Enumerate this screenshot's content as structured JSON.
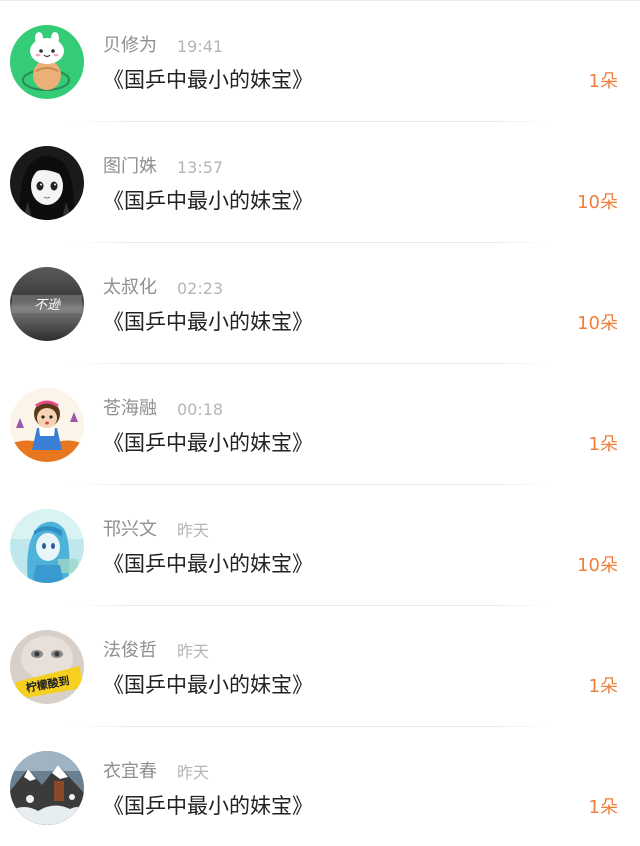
{
  "list": [
    {
      "name": "贝修为",
      "time": "19:41",
      "title": "《国乒中最小的妹宝》",
      "count": "1朵",
      "avatar_icon": "green-bunny-avatar"
    },
    {
      "name": "图门姝",
      "time": "13:57",
      "title": "《国乒中最小的妹宝》",
      "count": "10朵",
      "avatar_icon": "anime-girl-avatar"
    },
    {
      "name": "太叔化",
      "time": "02:23",
      "title": "《国乒中最小的妹宝》",
      "count": "10朵",
      "avatar_icon": "calligraphy-avatar",
      "avatar_text": "不逊"
    },
    {
      "name": "苍海融",
      "time": "00:18",
      "title": "《国乒中最小的妹宝》",
      "count": "1朵",
      "avatar_icon": "cartoon-girl-avatar"
    },
    {
      "name": "邗兴文",
      "time": "昨天",
      "title": "《国乒中最小的妹宝》",
      "count": "10朵",
      "avatar_icon": "blue-anime-avatar"
    },
    {
      "name": "法俊哲",
      "time": "昨天",
      "title": "《国乒中最小的妹宝》",
      "count": "1朵",
      "avatar_icon": "face-text-avatar",
      "avatar_text": "柠檬酸到"
    },
    {
      "name": "衣宜春",
      "time": "昨天",
      "title": "《国乒中最小的妹宝》",
      "count": "1朵",
      "avatar_icon": "snow-mountain-avatar"
    }
  ],
  "colors": {
    "count": "#f07f3c",
    "name": "#8f8f8f",
    "time": "#b5b5b5",
    "title": "#222222"
  }
}
